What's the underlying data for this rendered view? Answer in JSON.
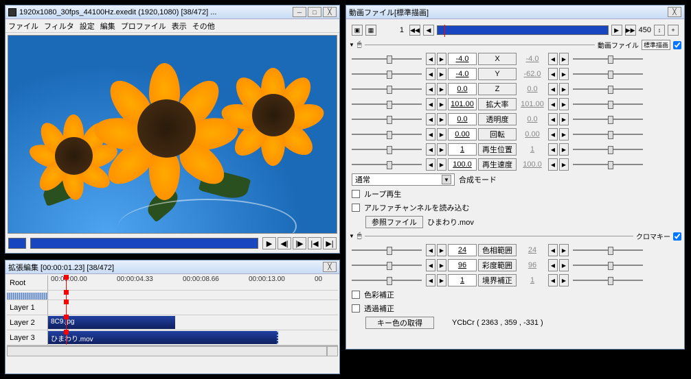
{
  "main": {
    "title": "1920x1080_30fps_44100Hz.exedit  (1920,1080)  [38/472]  ...",
    "menu": [
      "ファイル",
      "フィルタ",
      "設定",
      "編集",
      "プロファイル",
      "表示",
      "その他"
    ]
  },
  "timeline": {
    "title": "拡張編集 [00:00:01.23] [38/472]",
    "root": "Root",
    "ticks": [
      "00:00:00.00",
      "00:00:04.33",
      "00:00:08.66",
      "00:00:13.00",
      "00"
    ],
    "layers": [
      "Layer 1",
      "Layer 2",
      "Layer 3"
    ],
    "clip2": "8C9.jpg",
    "clip3": "ひまわり.mov"
  },
  "prop": {
    "title": "動画ファイル[標準描画]",
    "frame_cur": "1",
    "frame_total": "450",
    "section1": "動画ファイル",
    "section1_sub": "標準描画",
    "section2": "クロマキー",
    "params": [
      {
        "name": "X",
        "l": "-4.0",
        "r": "-4.0"
      },
      {
        "name": "Y",
        "l": "-4.0",
        "r": "-62.0"
      },
      {
        "name": "Z",
        "l": "0.0",
        "r": "0.0"
      },
      {
        "name": "拡大率",
        "l": "101.00",
        "r": "101.00"
      },
      {
        "name": "透明度",
        "l": "0.0",
        "r": "0.0"
      },
      {
        "name": "回転",
        "l": "0.00",
        "r": "0.00"
      },
      {
        "name": "再生位置",
        "l": "1",
        "r": "1"
      },
      {
        "name": "再生速度",
        "l": "100.0",
        "r": "100.0"
      }
    ],
    "blend_mode": "通常",
    "blend_label": "合成モード",
    "loop": "ループ再生",
    "alpha": "アルファチャンネルを読み込む",
    "ref_btn": "参照ファイル",
    "ref_file": "ひまわり.mov",
    "chroma_params": [
      {
        "name": "色相範囲",
        "l": "24",
        "r": "24"
      },
      {
        "name": "彩度範囲",
        "l": "96",
        "r": "96"
      },
      {
        "name": "境界補正",
        "l": "1",
        "r": "1"
      }
    ],
    "color_corr": "色彩補正",
    "trans_corr": "透過補正",
    "key_btn": "キー色の取得",
    "key_val": "YCbCr ( 2363 , 359 , -331 )"
  }
}
